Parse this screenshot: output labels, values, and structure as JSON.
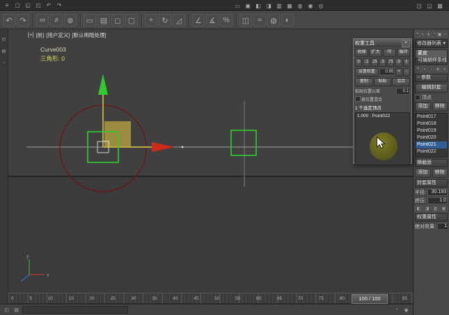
{
  "icons": {
    "menu": "≡",
    "new_scene": "▢",
    "open": "◱",
    "save": "◰",
    "undo": "↶",
    "redo": "↷",
    "m1": "▭",
    "m2": "▣",
    "m3": "◧",
    "m4": "◨",
    "m5": "▥",
    "m6": "▦",
    "m7": "◍",
    "m8": "◉",
    "m9": "◎",
    "r1": "◳",
    "r2": "◲",
    "r3": "▩",
    "link": "∞",
    "unlink": "≠",
    "bind": "⊗",
    "select": "▭",
    "select_name": "▤",
    "region": "◻",
    "crossing": "▢",
    "move": "+",
    "rotate": "↻",
    "scale": "◿",
    "snap": "∠",
    "angle_snap": "∡",
    "percent_snap": "%",
    "mirror": "◫",
    "align": "≈",
    "material": "◍",
    "render": "◐",
    "tab_create": "+",
    "tab_modify": "∿",
    "tab_hierarchy": "⋔",
    "tab_motion": "◔",
    "tab_display": "▣",
    "tab_utility": "⌂",
    "pin": "⌖",
    "stack_list": "≡",
    "show_end": "▪",
    "unique": "▫",
    "remove_mod": "⊗",
    "s1": "◰",
    "s2": "▤",
    "s3": "◔",
    "dropdown_arrow": "▾",
    "close": "×"
  },
  "viewport": {
    "label_plus": "[+]",
    "label_view": "[前]",
    "label_style": "[用户定义]",
    "label_shading": "[默认明暗处理]",
    "object_name": "Curve003",
    "stats": "三角形: 0",
    "axis_x": "x",
    "axis_y": "y"
  },
  "weight_tool": {
    "title": "权重工具",
    "row1": [
      "收缩",
      "扩大",
      "环",
      "循环"
    ],
    "presets": [
      "0",
      ".1",
      ".25",
      ".5",
      ".75",
      ".9",
      "1"
    ],
    "set_weight": "设置权重",
    "weight_value": "0.95",
    "plus": "+",
    "minus": "-",
    "copy": "复制",
    "paste": "粘贴",
    "blend": "混合",
    "tolerance_label": "粘贴位置公差",
    "tolerance_value": "0.1",
    "blend_option": "按位置混合",
    "selected_info": "1 个选定顶点",
    "weight_list": [
      "1.000 : Point022"
    ]
  },
  "command_panel": {
    "modifier_list": "修改器列表",
    "collapse": "−",
    "stack": [
      "蒙皮",
      "可编辑样条线"
    ],
    "params": "参数",
    "edit_envelopes": "编辑封套",
    "vertices_option": "顶点",
    "add": "添加",
    "remove": "移除",
    "bones": [
      "Point017",
      "Point018",
      "Point019",
      "Point020",
      "Point021",
      "Point022"
    ],
    "cross_sections": "横截面",
    "envelope_props": "封套属性",
    "radius_label": "半径:",
    "radius_value": "30.193",
    "squash_label": "挤压:",
    "squash_value": "1.0",
    "weight_props": "权重属性",
    "abs_effect_label": "绝对效果:",
    "abs_effect_value": "1.0"
  },
  "timeline": {
    "labels": [
      "0",
      "5",
      "10",
      "15",
      "20",
      "25",
      "30",
      "35",
      "40",
      "45",
      "50",
      "55",
      "60",
      "65",
      "70",
      "75",
      "80",
      "85",
      "90",
      "95"
    ],
    "frame_display": "100 / 100"
  },
  "colors": {
    "selection_blue": "#2f5f95",
    "gizmo_green": "#2ecc2e",
    "gizmo_red": "#cf2a1a",
    "axis_shaft_yellow": "#b7a93c",
    "circle_dark_red": "#6e1414",
    "khaki_fill": "#a3923f",
    "click_highlight_olive": "#6b6b1f"
  }
}
